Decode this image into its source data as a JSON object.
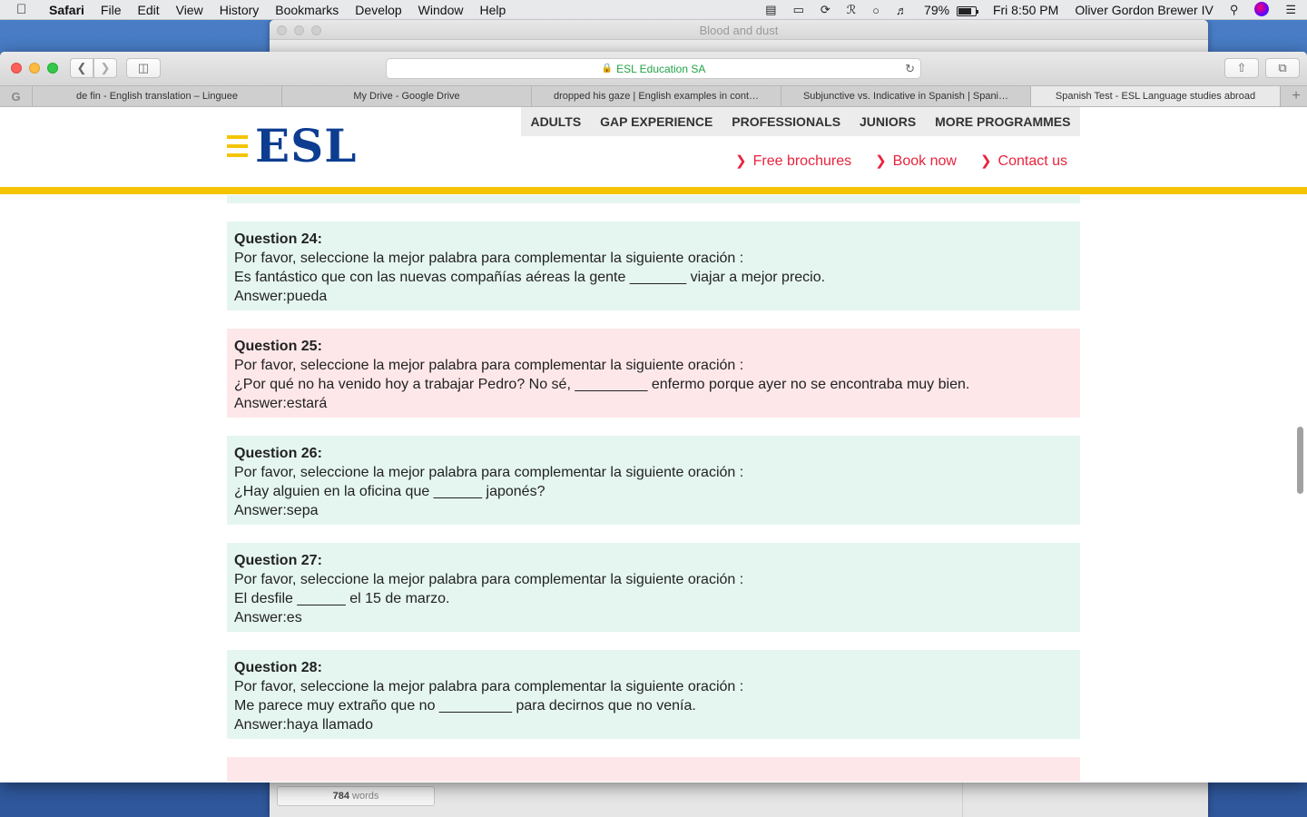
{
  "menubar": {
    "app_name": "Safari",
    "items": [
      "File",
      "Edit",
      "View",
      "History",
      "Bookmarks",
      "Develop",
      "Window",
      "Help"
    ],
    "battery_percent": "79%",
    "battery_level": 0.79,
    "clock": "Fri 8:50 PM",
    "user": "Oliver Gordon Brewer IV"
  },
  "background_window": {
    "title": "Blood and dust",
    "word_count": "784",
    "word_label": "words"
  },
  "safari": {
    "address": "ESL Education SA",
    "tabs": [
      {
        "label": "de fin - English translation – Linguee",
        "active": false
      },
      {
        "label": "My Drive - Google Drive",
        "active": false
      },
      {
        "label": "dropped his gaze | English examples in cont…",
        "active": false
      },
      {
        "label": "Subjunctive vs. Indicative in Spanish | Spani…",
        "active": false
      },
      {
        "label": "Spanish Test - ESL Language studies abroad",
        "active": true
      }
    ]
  },
  "site": {
    "logo_text": "ESL",
    "nav": [
      "ADULTS",
      "GAP EXPERIENCE",
      "PROFESSIONALS",
      "JUNIORS",
      "MORE PROGRAMMES"
    ],
    "subnav": [
      "Free brochures",
      "Book now",
      "Contact us"
    ],
    "colors": {
      "brand_blue": "#0c3d91",
      "accent_yellow": "#f5c400",
      "link_red": "#e8233d",
      "correct_bg": "#e5f6f0",
      "incorrect_bg": "#fde7e9"
    }
  },
  "questions": [
    {
      "title": "Question 24:",
      "prompt": "Por favor, seleccione la mejor palabra para complementar la siguiente oración :",
      "sentence": "Es fantástico que con las nuevas compañías aéreas la gente _______ viajar a mejor precio.",
      "answer": "Answer:pueda",
      "status": "correct"
    },
    {
      "title": "Question 25:",
      "prompt": "Por favor, seleccione la mejor palabra para complementar la siguiente oración :",
      "sentence": "¿Por qué no ha venido hoy a trabajar Pedro? No sé, _________ enfermo porque ayer no se encontraba muy bien.",
      "answer": "Answer:estará",
      "status": "incorrect"
    },
    {
      "title": "Question 26:",
      "prompt": "Por favor, seleccione la mejor palabra para complementar la siguiente oración :",
      "sentence": "¿Hay alguien en la oficina que ______ japonés?",
      "answer": "Answer:sepa",
      "status": "correct"
    },
    {
      "title": "Question 27:",
      "prompt": "Por favor, seleccione la mejor palabra para complementar la siguiente oración :",
      "sentence": "El desfile ______ el 15 de marzo.",
      "answer": "Answer:es",
      "status": "correct"
    },
    {
      "title": "Question 28:",
      "prompt": "Por favor, seleccione la mejor palabra para complementar la siguiente oración :",
      "sentence": "Me parece muy extraño que no _________ para decirnos que no venía.",
      "answer": "Answer:haya llamado",
      "status": "correct"
    },
    {
      "title": "",
      "prompt": "",
      "sentence": "",
      "answer": "",
      "status": "incorrect"
    }
  ]
}
